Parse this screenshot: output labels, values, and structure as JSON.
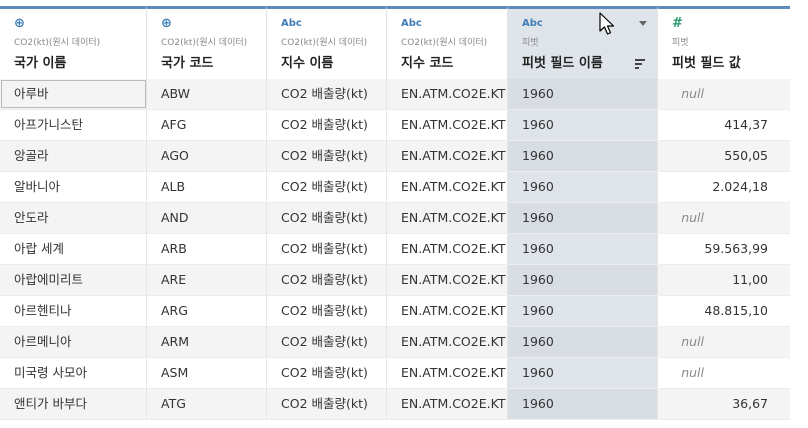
{
  "columns": [
    {
      "type_icon": "⊕",
      "type": "geo",
      "source": "CO2(kt)(원시 데이터)",
      "name": "국가 이름"
    },
    {
      "type_icon": "⊕",
      "type": "geo",
      "source": "CO2(kt)(원시 데이터)",
      "name": "국가 코드"
    },
    {
      "type_icon": "Abc",
      "type": "string",
      "source": "CO2(kt)(원시 데이터)",
      "name": "지수 이름"
    },
    {
      "type_icon": "Abc",
      "type": "string",
      "source": "CO2(kt)(원시 데이터)",
      "name": "지수 코드"
    },
    {
      "type_icon": "Abc",
      "type": "string",
      "source": "피벗",
      "name": "피벗 필드 이름"
    },
    {
      "type_icon": "#",
      "type": "number",
      "source": "피벗",
      "name": "피벗 필드 값"
    }
  ],
  "rows": [
    [
      "아루바",
      "ABW",
      "CO2 배출량(kt)",
      "EN.ATM.CO2E.KT",
      "1960",
      "null"
    ],
    [
      "아프가니스탄",
      "AFG",
      "CO2 배출량(kt)",
      "EN.ATM.CO2E.KT",
      "1960",
      "414,37"
    ],
    [
      "앙골라",
      "AGO",
      "CO2 배출량(kt)",
      "EN.ATM.CO2E.KT",
      "1960",
      "550,05"
    ],
    [
      "알바니아",
      "ALB",
      "CO2 배출량(kt)",
      "EN.ATM.CO2E.KT",
      "1960",
      "2.024,18"
    ],
    [
      "안도라",
      "AND",
      "CO2 배출량(kt)",
      "EN.ATM.CO2E.KT",
      "1960",
      "null"
    ],
    [
      "아랍 세계",
      "ARB",
      "CO2 배출량(kt)",
      "EN.ATM.CO2E.KT",
      "1960",
      "59.563,99"
    ],
    [
      "아랍에미리트",
      "ARE",
      "CO2 배출량(kt)",
      "EN.ATM.CO2E.KT",
      "1960",
      "11,00"
    ],
    [
      "아르헨티나",
      "ARG",
      "CO2 배출량(kt)",
      "EN.ATM.CO2E.KT",
      "1960",
      "48.815,10"
    ],
    [
      "아르메니아",
      "ARM",
      "CO2 배출량(kt)",
      "EN.ATM.CO2E.KT",
      "1960",
      "null"
    ],
    [
      "미국령 사모아",
      "ASM",
      "CO2 배출량(kt)",
      "EN.ATM.CO2E.KT",
      "1960",
      "null"
    ],
    [
      "앤티가 바부다",
      "ATG",
      "CO2 배출량(kt)",
      "EN.ATM.CO2E.KT",
      "1960",
      "36,67"
    ]
  ],
  "selected_column": 4,
  "colors": {
    "accent": "#5b8cbb",
    "selected_bg": "#dfe4ea",
    "geo_icon": "#3f7db6",
    "number_icon": "#2e9b70"
  }
}
